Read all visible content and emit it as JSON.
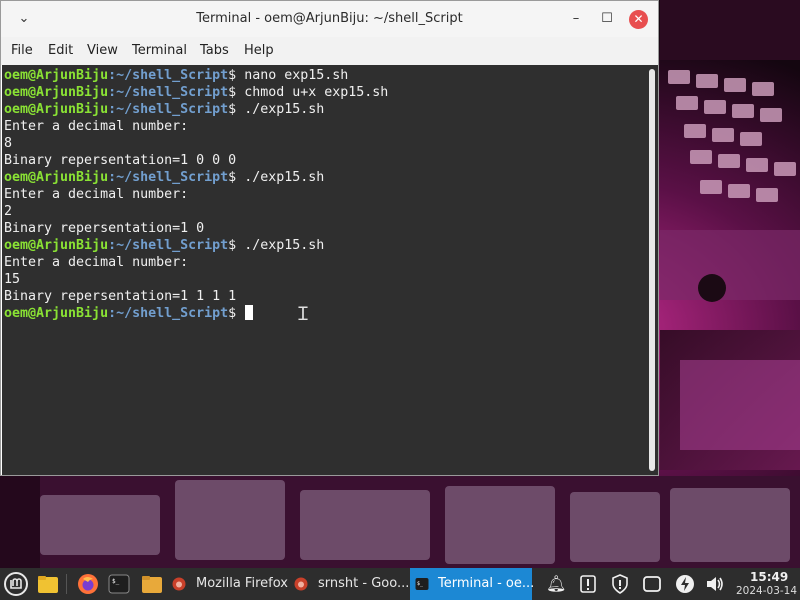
{
  "window": {
    "title": "Terminal - oem@ArjunBiju: ~/shell_Script",
    "collapse_icon": "chevron-down-icon",
    "min_label": "–",
    "max_label": "☐",
    "close_label": "✕"
  },
  "menu": [
    "File",
    "Edit",
    "View",
    "Terminal",
    "Tabs",
    "Help"
  ],
  "prompt": {
    "user": "oem@ArjunBiju",
    "path": ":~/shell_Script",
    "symbol": "$ "
  },
  "terminal_lines": [
    {
      "type": "prompt",
      "cmd": "nano exp15.sh"
    },
    {
      "type": "prompt",
      "cmd": "chmod u+x exp15.sh"
    },
    {
      "type": "prompt",
      "cmd": "./exp15.sh"
    },
    {
      "type": "output",
      "text": "Enter a decimal number:"
    },
    {
      "type": "output",
      "text": "8"
    },
    {
      "type": "output",
      "text": "Binary repersentation=1 0 0 0"
    },
    {
      "type": "prompt",
      "cmd": "./exp15.sh"
    },
    {
      "type": "output",
      "text": "Enter a decimal number:"
    },
    {
      "type": "output",
      "text": "2"
    },
    {
      "type": "output",
      "text": "Binary repersentation=1 0"
    },
    {
      "type": "prompt",
      "cmd": "./exp15.sh"
    },
    {
      "type": "output",
      "text": "Enter a decimal number:"
    },
    {
      "type": "output",
      "text": "15"
    },
    {
      "type": "output",
      "text": "Binary repersentation=1 1 1 1"
    },
    {
      "type": "prompt",
      "cmd": "",
      "cursor": true
    }
  ],
  "taskbar": {
    "tasks": [
      {
        "label": "Mozilla Firefox",
        "icon": "firefox-icon"
      },
      {
        "label": "srnsht - Goo...",
        "icon": "browser-icon"
      },
      {
        "label": "Terminal - oe...",
        "icon": "terminal-icon",
        "active": true
      }
    ],
    "clock": {
      "time": "15:49",
      "date": "2024-03-14"
    }
  },
  "colors": {
    "prompt_user": "#8ae234",
    "prompt_path": "#729fcf",
    "terminal_bg": "#2f2f2f",
    "active_task": "#1c88d4"
  }
}
